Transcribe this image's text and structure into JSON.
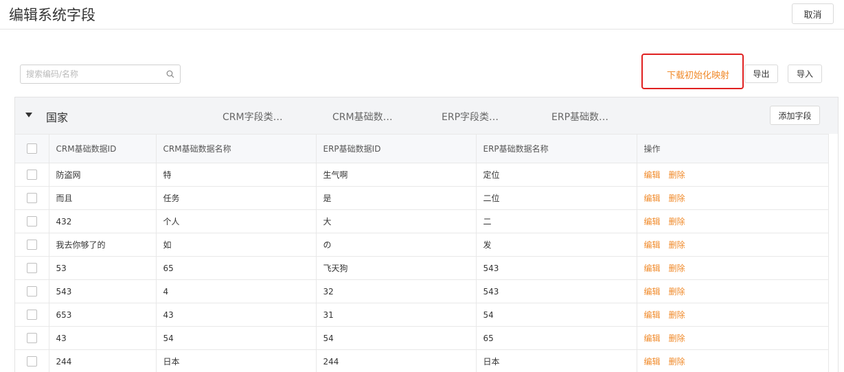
{
  "header": {
    "title": "编辑系统字段",
    "cancel_label": "取消"
  },
  "toolbar": {
    "search_placeholder": "搜索编码/名称",
    "download_label": "下载初始化映射",
    "export_label": "导出",
    "import_label": "导入"
  },
  "group": {
    "name": "国家",
    "meta": [
      "CRM字段类…",
      "CRM基础数…",
      "ERP字段类…",
      "ERP基础数…"
    ],
    "add_field_label": "添加字段"
  },
  "table": {
    "columns": [
      "CRM基础数据ID",
      "CRM基础数据名称",
      "ERP基础数据ID",
      "ERP基础数据名称",
      "操作"
    ],
    "actions": [
      "编辑",
      "删除"
    ],
    "rows": [
      [
        "防盗网",
        "特",
        "生气啊",
        "定位"
      ],
      [
        "而且",
        "任务",
        "是",
        "二位"
      ],
      [
        "432",
        "个人",
        "大",
        "二"
      ],
      [
        "我去你够了的",
        "如",
        "の",
        "发"
      ],
      [
        "53",
        "65",
        "飞天狗",
        "543"
      ],
      [
        "543",
        "4",
        "32",
        "543"
      ],
      [
        "653",
        "43",
        "31",
        "54"
      ],
      [
        "43",
        "54",
        "54",
        "65"
      ],
      [
        "244",
        "日本",
        "244",
        "日本"
      ]
    ]
  },
  "colors": {
    "accent": "#f08a2a",
    "highlight": "#e02020",
    "header_bg": "#f3f4f6"
  }
}
